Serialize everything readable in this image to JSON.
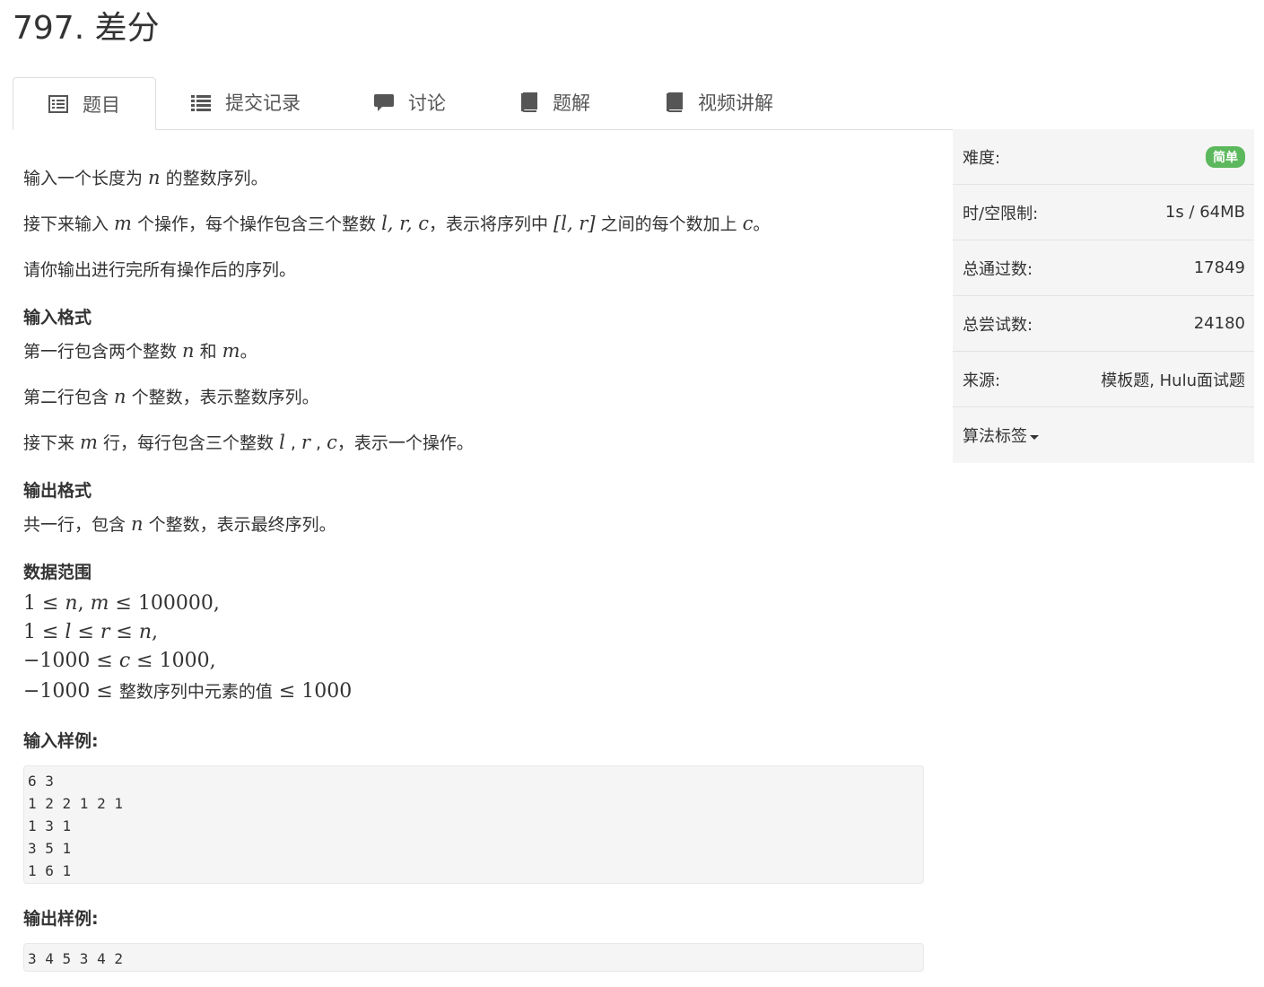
{
  "page_title": "797. 差分",
  "tabs": [
    {
      "label": "题目",
      "icon": "list-alt-icon",
      "active": true
    },
    {
      "label": "提交记录",
      "icon": "list-icon",
      "active": false
    },
    {
      "label": "讨论",
      "icon": "comment-icon",
      "active": false
    },
    {
      "label": "题解",
      "icon": "book-icon",
      "active": false
    },
    {
      "label": "视频讲解",
      "icon": "book-icon",
      "active": false
    }
  ],
  "problem": {
    "p1": {
      "a": "输入一个长度为 ",
      "v1": "n",
      "b": " 的整数序列。"
    },
    "p2": {
      "a": "接下来输入 ",
      "v1": "m",
      "b": " 个操作，每个操作包含三个整数 ",
      "v2": "l, r, c",
      "c": "，表示将序列中 ",
      "v3": "[l, r]",
      "d": " 之间的每个数加上 ",
      "v4": "c",
      "e": "。"
    },
    "p3": "请你输出进行完所有操作后的序列。",
    "input_format_heading": "输入格式",
    "if1": {
      "a": "第一行包含两个整数 ",
      "v1": "n",
      "b": " 和 ",
      "v2": "m",
      "c": "。"
    },
    "if2": {
      "a": "第二行包含 ",
      "v1": "n",
      "b": " 个整数，表示整数序列。"
    },
    "if3": {
      "a": "接下来 ",
      "v1": "m",
      "b": " 行，每行包含三个整数 ",
      "v2": "l",
      "c": " , ",
      "v3": "r",
      "d": " , ",
      "v4": "c",
      "e": "，表示一个操作。"
    },
    "output_format_heading": "输出格式",
    "of1": {
      "a": "共一行，包含 ",
      "v1": "n",
      "b": " 个整数，表示最终序列。"
    },
    "range_heading": "数据范围",
    "range": {
      "l1a": "1 ≤ ",
      "l1v": "n",
      "l1b": ", ",
      "l1v2": "m",
      "l1c": " ≤ 100000,",
      "l2a": "1 ≤ ",
      "l2v": "l",
      "l2b": " ≤ ",
      "l2v2": "r",
      "l2c": " ≤ ",
      "l2v3": "n",
      "l2d": ",",
      "l3a": "−1000 ≤ ",
      "l3v": "c",
      "l3b": " ≤ 1000,",
      "l4a": "−1000 ≤ ",
      "l4zh": "整数序列中元素的值",
      "l4b": " ≤ 1000"
    },
    "sample_input_heading": "输入样例:",
    "sample_input": [
      "6 3",
      "1 2 2 1 2 1",
      "1 3 1",
      "3 5 1",
      "1 6 1"
    ],
    "sample_output_heading": "输出样例:",
    "sample_output": [
      "3 4 5 3 4 2"
    ]
  },
  "sidebar": {
    "difficulty_label": "难度:",
    "difficulty_value": "简单",
    "limit_label": "时/空限制:",
    "limit_value": "1s / 64MB",
    "passed_label": "总通过数:",
    "passed_value": "17849",
    "tried_label": "总尝试数:",
    "tried_value": "24180",
    "source_label": "来源:",
    "source_value": "模板题, Hulu面试题",
    "tags_label": "算法标签"
  },
  "colors": {
    "badge": "#5cb85c",
    "sidebar_bg": "#f5f5f5",
    "code_bg": "#f5f5f5"
  }
}
